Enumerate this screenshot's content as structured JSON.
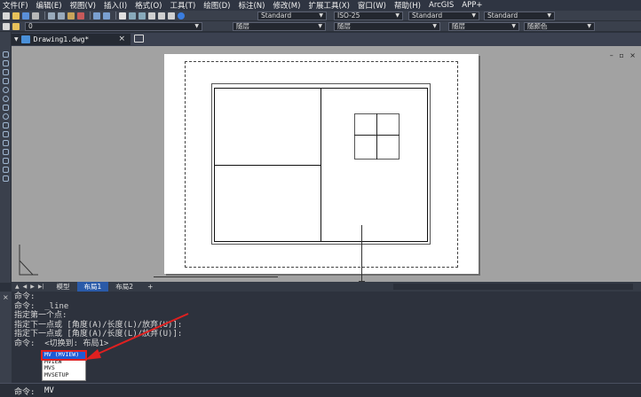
{
  "menu": [
    "文件(F)",
    "编辑(E)",
    "视图(V)",
    "插入(I)",
    "格式(O)",
    "工具(T)",
    "绘图(D)",
    "标注(N)",
    "修改(M)",
    "扩展工具(X)",
    "窗口(W)",
    "帮助(H)",
    "ArcGIS",
    "APP+"
  ],
  "toolbar": {
    "text_style": "Standard",
    "dim_style": "ISO-25",
    "table_style": "Standard",
    "multileader_style": "Standard",
    "layer": "0",
    "color": "随层",
    "linetype": "随层",
    "lineweight": "随层",
    "plot_style": "随颜色"
  },
  "document": {
    "title": "Drawing1.dwg*",
    "close": "×"
  },
  "layout_tabs": [
    "模型",
    "布局1",
    "布局2",
    "+"
  ],
  "active_layout": "布局1",
  "command_history": [
    "命令:  _line",
    "指定第一个点:",
    "指定下一点或 [角度(A)/长度(L)/放弃(U)]:",
    "指定下一点或 [角度(A)/长度(L)/放弃(U)]:",
    "命令:  <切换到: 布局1>"
  ],
  "command_history_top": "命令:",
  "autocomplete": [
    "MV (MVIEW)",
    "MVIEW",
    "MVS",
    "MVSETUP"
  ],
  "command_prompt": "命令:",
  "command_input": "MV",
  "colors": {
    "accent": "#2a5aa8",
    "selection": "#1e5bd6",
    "highlight_red": "#e02020"
  }
}
